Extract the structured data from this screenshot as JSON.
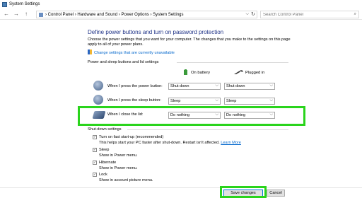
{
  "window": {
    "title": "System Settings"
  },
  "nav": {
    "back": "←",
    "forward": "→",
    "up": "↑"
  },
  "address": {
    "segments": [
      "Control Panel",
      "Hardware and Sound",
      "Power Options",
      "System Settings"
    ],
    "separator": "›"
  },
  "search": {
    "placeholder": "Search Control Panel"
  },
  "page": {
    "heading": "Define power buttons and turn on password protection",
    "intro": "Choose the power settings that you want for your computer. The changes that you make to the settings on this page apply to all of your power plans.",
    "unavailable_link": "Change settings that are currently unavailable"
  },
  "power_section": {
    "header": "Power and sleep buttons and lid settings",
    "col_battery": "On battery",
    "col_plugged": "Plugged in",
    "rows": [
      {
        "label": "When I press the power button:",
        "battery": "Shut down",
        "plugged": "Shut down"
      },
      {
        "label": "When I press the sleep button:",
        "battery": "Sleep",
        "plugged": "Sleep"
      },
      {
        "label": "When I close the lid:",
        "battery": "Do nothing",
        "plugged": "Do nothing"
      }
    ]
  },
  "shutdown_section": {
    "header": "Shut-down settings",
    "items": [
      {
        "title": "Turn on fast start-up (recommended)",
        "desc": "This helps start your PC faster after shut-down. Restart isn't affected.",
        "link": "Learn More",
        "checked": true
      },
      {
        "title": "Sleep",
        "desc": "Show in Power menu.",
        "checked": true
      },
      {
        "title": "Hibernate",
        "desc": "Show in Power menu.",
        "checked": true
      },
      {
        "title": "Lock",
        "desc": "Show in account picture menu.",
        "checked": true
      }
    ]
  },
  "footer": {
    "save": "Save changes",
    "cancel": "Cancel"
  },
  "colors": {
    "heading": "#1e3287",
    "link": "#0066cc",
    "highlight": "#2ad41c"
  },
  "icons": {
    "check": "✓",
    "dropdown": "⌵",
    "refresh": "↻",
    "search": "⌕"
  }
}
